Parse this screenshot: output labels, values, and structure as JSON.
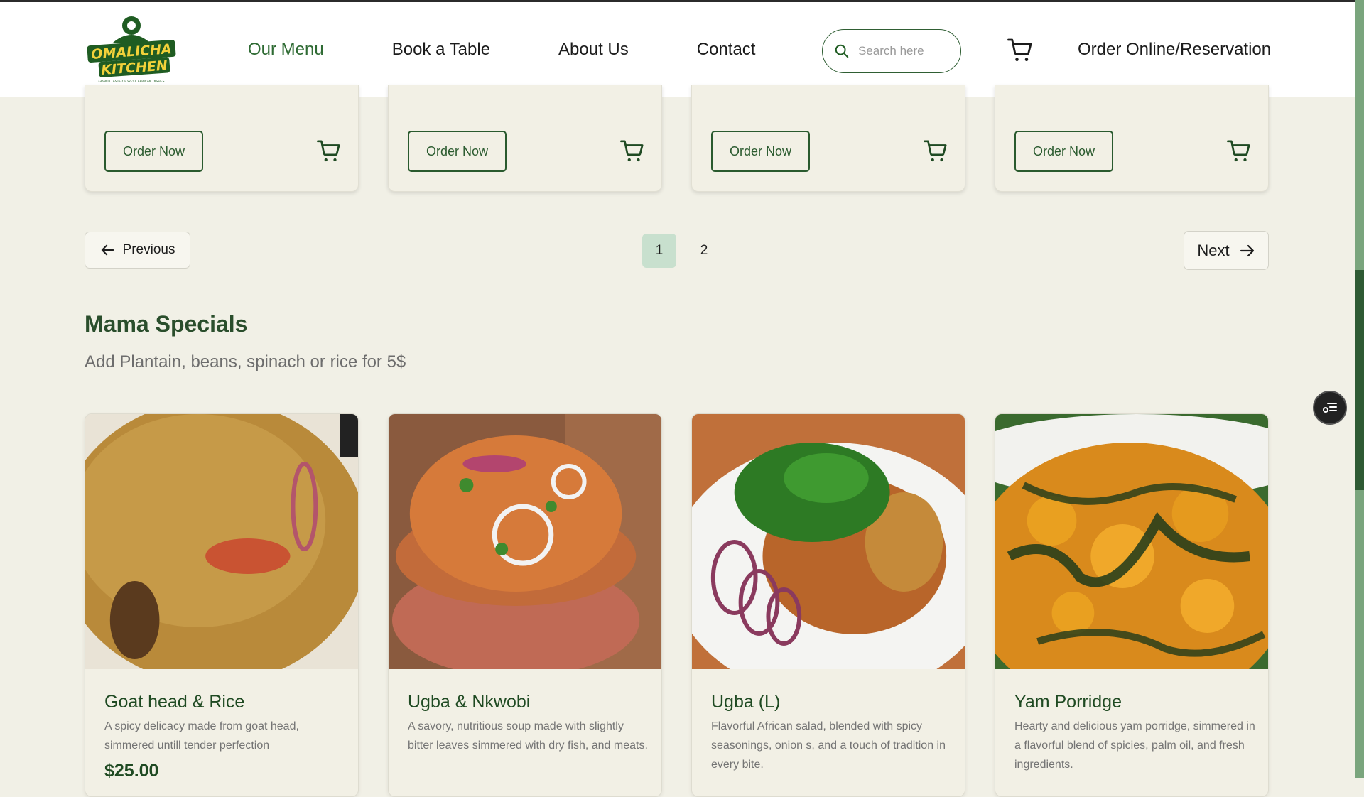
{
  "header": {
    "logo": {
      "line1": "OMALICHA",
      "line2": "KITCHEN",
      "tagline": "GRAND TASTE OF WEST AFRICAN DISHES"
    },
    "nav": [
      {
        "label": "Our Menu",
        "active": true
      },
      {
        "label": "Book a Table",
        "active": false
      },
      {
        "label": "About Us",
        "active": false
      },
      {
        "label": "Contact",
        "active": false
      }
    ],
    "search_placeholder": "Search here",
    "cta_label": "Order Online/Reservation"
  },
  "top_cards": [
    {
      "order_label": "Order Now"
    },
    {
      "order_label": "Order Now"
    },
    {
      "order_label": "Order Now"
    },
    {
      "order_label": "Order Now"
    }
  ],
  "pagination": {
    "prev_label": "Previous",
    "next_label": "Next",
    "pages": [
      "1",
      "2"
    ],
    "current_page": "1"
  },
  "section": {
    "title": "Mama Specials",
    "subtitle": "Add Plantain, beans, spinach or rice for 5$"
  },
  "products": [
    {
      "name": "Goat head & Rice",
      "description": "A spicy delicacy made from goat head, simmered untill tender perfection",
      "price": "$25.00"
    },
    {
      "name": "Ugba & Nkwobi",
      "description": "A savory, nutritious soup made with slightly bitter leaves simmered with dry fish, and meats.",
      "price": ""
    },
    {
      "name": "Ugba (L)",
      "description": "Flavorful African salad, blended with spicy seasonings, onion s, and a touch of tradition in every bite.",
      "price": ""
    },
    {
      "name": "Yam Porridge",
      "description": "Hearty and delicious yam porridge, simmered in a flavorful blend of spicies, palm oil, and fresh ingredients.",
      "price": ""
    }
  ],
  "colors": {
    "brand_green": "#2a5a2e",
    "background": "#f1f0e6",
    "active_page": "#c8e0ce"
  },
  "icons": [
    "search-icon",
    "cart-icon",
    "arrow-left-icon",
    "arrow-right-icon",
    "filter-list-icon"
  ]
}
